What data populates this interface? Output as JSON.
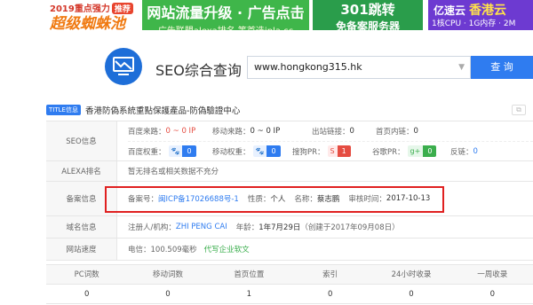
{
  "ads": {
    "ad1": {
      "line1": "2019重点强力",
      "tag": "推荐",
      "line2": "超级蜘蛛池"
    },
    "ad2": {
      "line1": "网站流量升级 · 广告点击",
      "line2": "广告联盟alexa排名 等首选ipla.cc"
    },
    "ad3": {
      "line1": "301跳转",
      "line2": "免备案服务器"
    },
    "ad4": {
      "brand": "亿速云",
      "hk": "香港云",
      "line2": "1核CPU · 1G内存 · 2M"
    }
  },
  "header": {
    "title": "SEO综合查询",
    "search_value": "www.hongkong315.hk",
    "search_button": "查 询"
  },
  "titlebar": {
    "tag": "TITLE信息",
    "text": "香港防偽系統重點保護產品-防偽驗證中心"
  },
  "seo": {
    "label": "SEO信息",
    "baidu_traffic_label": "百度来路：",
    "baidu_traffic_value": "0 ~ 0 IP",
    "mobile_traffic_label": "移动来路：",
    "mobile_traffic_value": "0 ~ 0 IP",
    "outlinks_label": "出站链接：",
    "outlinks_value": "0",
    "home_internal_label": "首页内链：",
    "home_internal_value": "0",
    "baidu_weight_label": "百度权重：",
    "baidu_weight_value": "0",
    "mobile_weight_label": "移动权重：",
    "mobile_weight_value": "0",
    "sogou_label": "搜狗PR：",
    "sogou_value": "1",
    "google_label": "谷歌PR：",
    "google_value": "0",
    "backlinks_label": "反链：",
    "backlinks_value": "0"
  },
  "alexa": {
    "label": "ALEXA排名",
    "text": "暂无排名或相关数据不充分"
  },
  "icp": {
    "label": "备案信息",
    "num_label": "备案号：",
    "num_value": "闽ICP备17026688号-1",
    "nature_label": "性质：",
    "nature_value": "个人",
    "name_label": "名称：",
    "name_value": "蔡志鹏",
    "date_label": "审核时间：",
    "date_value": "2017-10-13"
  },
  "domain": {
    "label": "域名信息",
    "registrant_label": "注册人/机构：",
    "registrant_value": "ZHI PENG CAI",
    "age_label": "年龄：",
    "age_value": "1年7月29日",
    "created": "（创建于2017年09月08日）"
  },
  "speed": {
    "label": "网站速度",
    "telecom": "电信：100.509毫秒",
    "link": "代写企业软文"
  },
  "stats": {
    "headers": [
      "PC词数",
      "移动词数",
      "首页位置",
      "索引",
      "24小时收录",
      "一周收录"
    ],
    "values": [
      "0",
      "0",
      "1",
      "0",
      "0",
      "0"
    ]
  },
  "colors": {
    "accent": "#2f7cf0",
    "highlight": "#e02020"
  }
}
